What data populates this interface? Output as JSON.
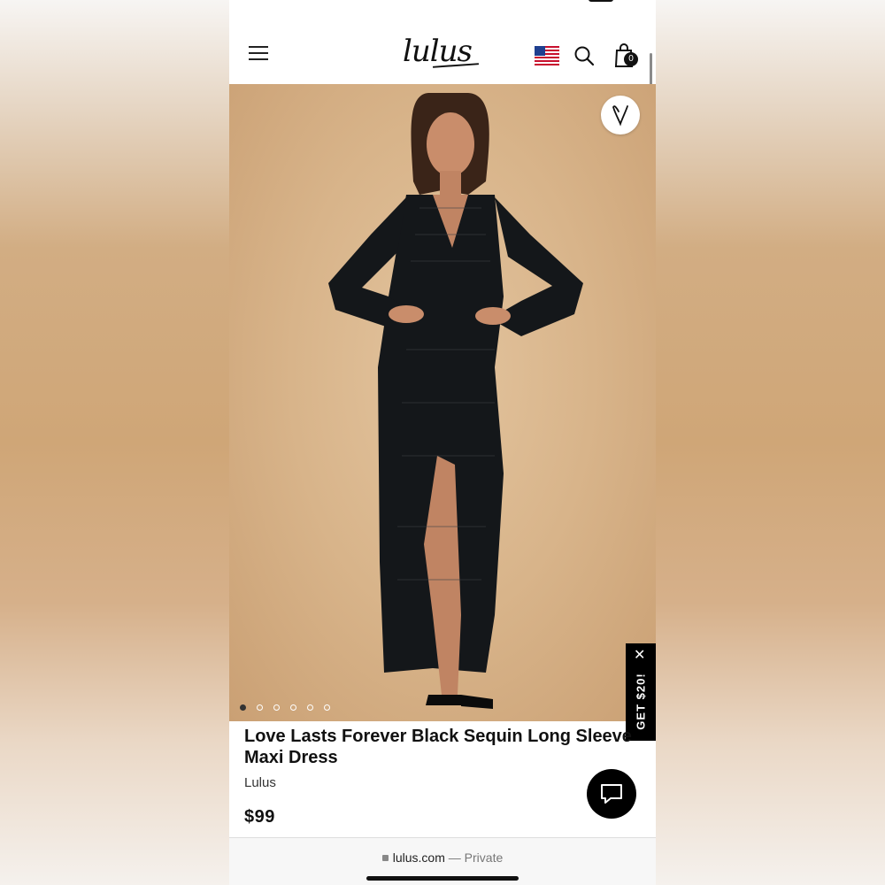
{
  "header": {
    "logo": "lulus",
    "cart_count": "0"
  },
  "product": {
    "title": "Love Lasts Forever Black Sequin Long Sleeve Maxi Dress",
    "brand": "Lulus",
    "price": "$99",
    "image_count": 6,
    "active_image_index": 0
  },
  "promo": {
    "label": "GET $20!",
    "close": "✕"
  },
  "browser": {
    "domain": "lulus.com",
    "separator": " — ",
    "mode": "Private"
  },
  "colors": {
    "background_beige": "#d8b48a",
    "text": "#111111",
    "promo_bg": "#000000"
  },
  "icons": [
    "menu-icon",
    "us-flag-icon",
    "search-icon",
    "shopping-bag-icon",
    "heart-icon",
    "close-icon",
    "chat-icon",
    "lock-icon"
  ]
}
